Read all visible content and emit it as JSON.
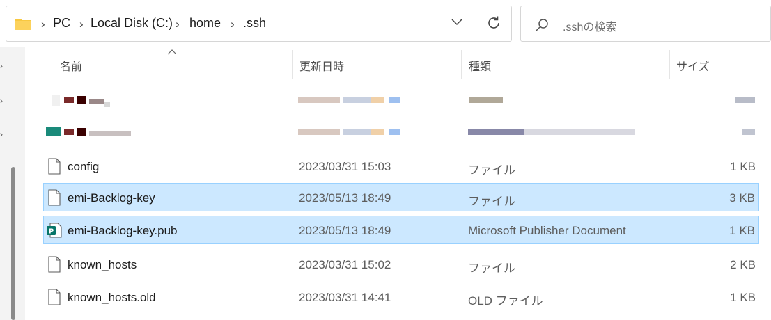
{
  "address_bar": {
    "crumbs": [
      "PC",
      "Local Disk (C:)",
      "home",
      ".ssh"
    ]
  },
  "search": {
    "placeholder": ".sshの検索"
  },
  "columns": {
    "name": "名前",
    "modified": "更新日時",
    "type": "種類",
    "size": "サイズ"
  },
  "files": [
    {
      "name": "config",
      "modified": "2023/03/31 15:03",
      "type": "ファイル",
      "size": "1 KB",
      "selected": false,
      "icon": "file-icon"
    },
    {
      "name": "emi-Backlog-key",
      "modified": "2023/05/13 18:49",
      "type": "ファイル",
      "size": "3 KB",
      "selected": true,
      "icon": "file-icon"
    },
    {
      "name": "emi-Backlog-key.pub",
      "modified": "2023/05/13 18:49",
      "type": "Microsoft Publisher Document",
      "size": "1 KB",
      "selected": true,
      "icon": "publisher-icon"
    },
    {
      "name": "known_hosts",
      "modified": "2023/03/31 15:02",
      "type": "ファイル",
      "size": "2 KB",
      "selected": false,
      "icon": "file-icon"
    },
    {
      "name": "known_hosts.old",
      "modified": "2023/03/31 14:41",
      "type": "OLD ファイル",
      "size": "1 KB",
      "selected": false,
      "icon": "file-icon"
    }
  ],
  "colors": {
    "selection": "#cce8ff",
    "selection_border": "#99d1ff",
    "folder": "#f8c840",
    "publisher": "#077568"
  }
}
